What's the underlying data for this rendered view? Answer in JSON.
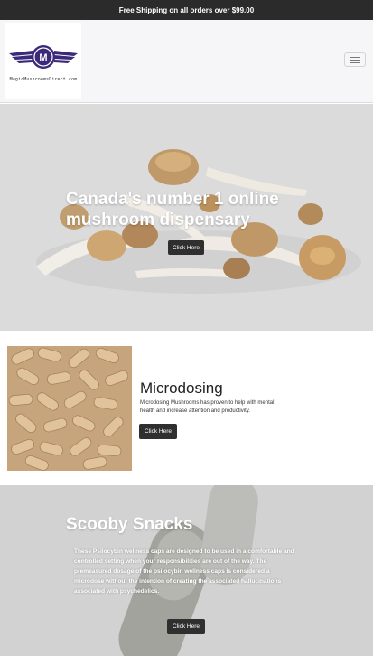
{
  "announcement": "Free Shipping on all orders over $99.00",
  "header": {
    "logo_letter": "M",
    "logo_text": "MagicMushroomsDirect.com"
  },
  "hero": {
    "title": "Canada's number 1 online mushroom dispensary",
    "button": "Click Here"
  },
  "microdosing": {
    "title": "Microdosing",
    "text": "Microdosing Mushrooms has proven to help with mental health and increase attention and productivity.",
    "button": "Click Here"
  },
  "scooby": {
    "title": "Scooby Snacks",
    "text": "These Psilocybin wellness caps are designed to be used in a comfortable and controlled setting when your responsibilities are out of the way. The premeasured dosage of the psilocybin wellness caps is considered a microdose without the intention of creating the associated hallucinations associated with psychedelics.",
    "button": "Click Here"
  },
  "colors": {
    "topbar": "#2b2b2b",
    "logo_purple": "#3b2a7a",
    "button_dark": "#2f2f2f"
  }
}
